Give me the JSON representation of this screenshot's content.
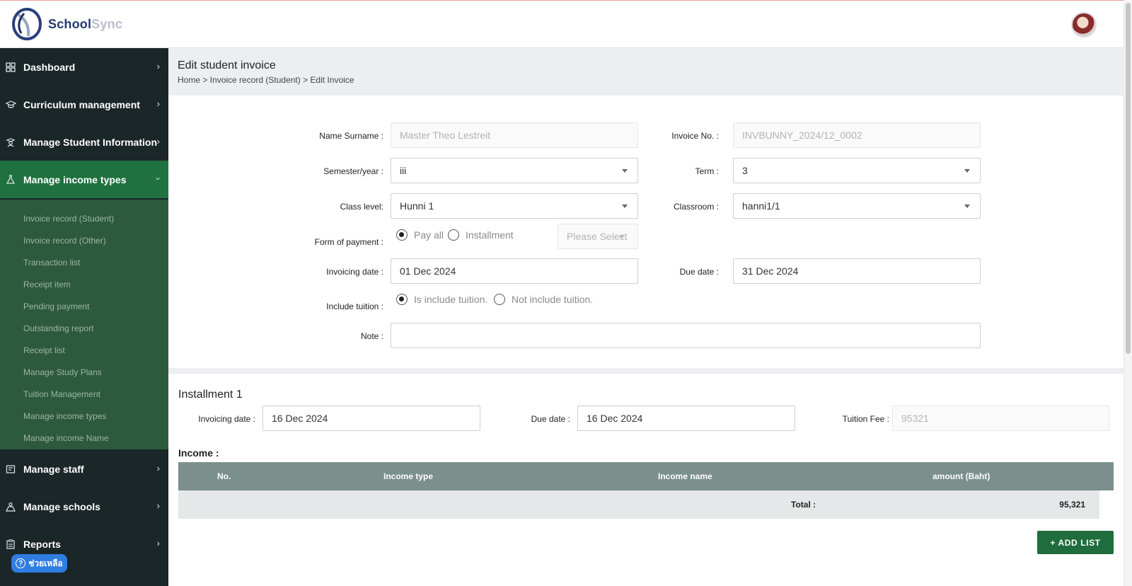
{
  "brand": {
    "school": "School",
    "sync": "Sync"
  },
  "sidebar": {
    "items": [
      {
        "label": "Dashboard",
        "icon": "grid-icon"
      },
      {
        "label": "Curriculum management",
        "icon": "graduation-cap-icon"
      },
      {
        "label": "Manage Student Information",
        "icon": "student-icon"
      },
      {
        "label": "Manage income types",
        "icon": "flask-icon"
      },
      {
        "label": "Manage staff",
        "icon": "staff-icon"
      },
      {
        "label": "Manage schools",
        "icon": "school-icon"
      },
      {
        "label": "Reports",
        "icon": "clipboard-icon"
      }
    ],
    "subitems": [
      "Invoice record (Student)",
      "Invoice record (Other)",
      "Transaction list",
      "Receipt item",
      "Pending payment",
      "Outstanding report",
      "Receipt list",
      "Manage Study Plans",
      "Tuition Management",
      "Manage income types",
      "Manage income Name"
    ],
    "help_label": "ช่วยเหลือ"
  },
  "header": {
    "title": "Edit student invoice",
    "breadcrumb": "Home > Invoice record (Student) > Edit Invoice"
  },
  "form": {
    "name_label": "Name Surname :",
    "name_value": "Master Theo Lestreit",
    "invoice_no_label": "Invoice No. :",
    "invoice_no_value": "INVBUNNY_2024/12_0002",
    "semester_label": "Semester/year :",
    "semester_value": "iii",
    "term_label": "Term :",
    "term_value": "3",
    "class_level_label": "Class level:",
    "class_level_value": "Hunni 1",
    "classroom_label": "Classroom :",
    "classroom_value": "hanni1/1",
    "payment_label": "Form of payment :",
    "pay_all_label": "Pay all",
    "installment_label": "Installment",
    "installment_select_placeholder": "Please Select",
    "invoicing_date_label": "Invoicing date :",
    "invoicing_date_value": "01 Dec 2024",
    "due_date_label": "Due date :",
    "due_date_value": "31 Dec 2024",
    "tuition_label": "Include tuition :",
    "tuition_yes_label": "Is include tuition.",
    "tuition_no_label": "Not include tuition.",
    "note_label": "Note :",
    "note_value": ""
  },
  "installment": {
    "title": "Installment 1",
    "invoicing_date_label": "Invoicing date :",
    "invoicing_date_value": "16 Dec 2024",
    "due_date_label": "Due date :",
    "due_date_value": "16 Dec 2024",
    "tuition_fee_label": "Tuition Fee :",
    "tuition_fee_value": "95321"
  },
  "income": {
    "title": "Income :",
    "columns": [
      "No.",
      "Income type",
      "Income name",
      "amount (Baht)"
    ],
    "total_label": "Total :",
    "total_value": "95,321",
    "add_button": "+ ADD LIST"
  },
  "colors": {
    "sidebar_bg": "#1b2629",
    "active_green": "#1f7240",
    "submenu_green": "#2d5a3d",
    "table_head": "#7b8f8d",
    "button_green": "#1f6d3d"
  }
}
